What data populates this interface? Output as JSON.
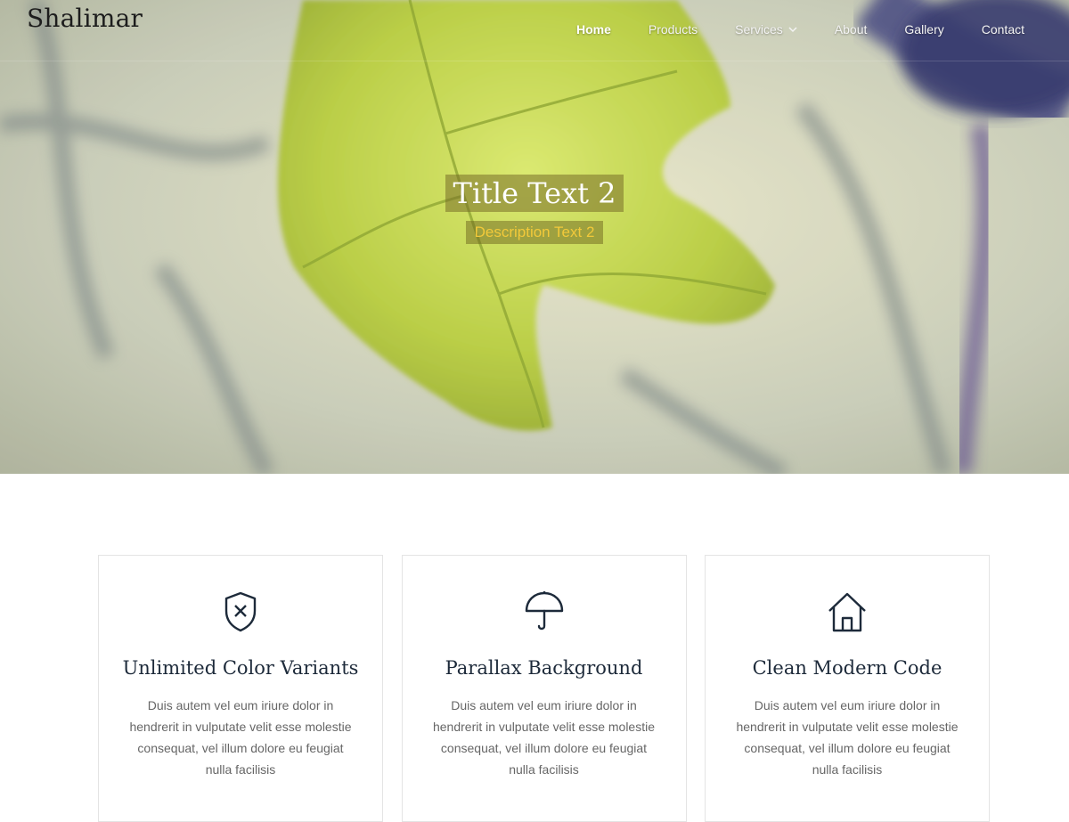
{
  "site": {
    "logo": "Shalimar"
  },
  "nav": {
    "items": [
      {
        "label": "Home",
        "active": true
      },
      {
        "label": "Products"
      },
      {
        "label": "Services",
        "has_dropdown": true
      },
      {
        "label": "About"
      },
      {
        "label": "Gallery"
      },
      {
        "label": "Contact"
      }
    ]
  },
  "hero": {
    "title": "Title Text 2",
    "description": "Description Text 2",
    "accent_color": "#f2c93a"
  },
  "features": [
    {
      "icon": "shield-x-icon",
      "title": "Unlimited Color Variants",
      "text": "Duis autem vel eum iriure dolor in hendrerit in vulputate velit esse molestie consequat, vel illum dolore eu feugiat nulla facilisis"
    },
    {
      "icon": "umbrella-icon",
      "title": "Parallax Background",
      "text": "Duis autem vel eum iriure dolor in hendrerit in vulputate velit esse molestie consequat, vel illum dolore eu feugiat nulla facilisis"
    },
    {
      "icon": "home-icon",
      "title": "Clean Modern Code",
      "text": "Duis autem vel eum iriure dolor in hendrerit in vulputate velit esse molestie consequat, vel illum dolore eu feugiat nulla facilisis"
    }
  ]
}
